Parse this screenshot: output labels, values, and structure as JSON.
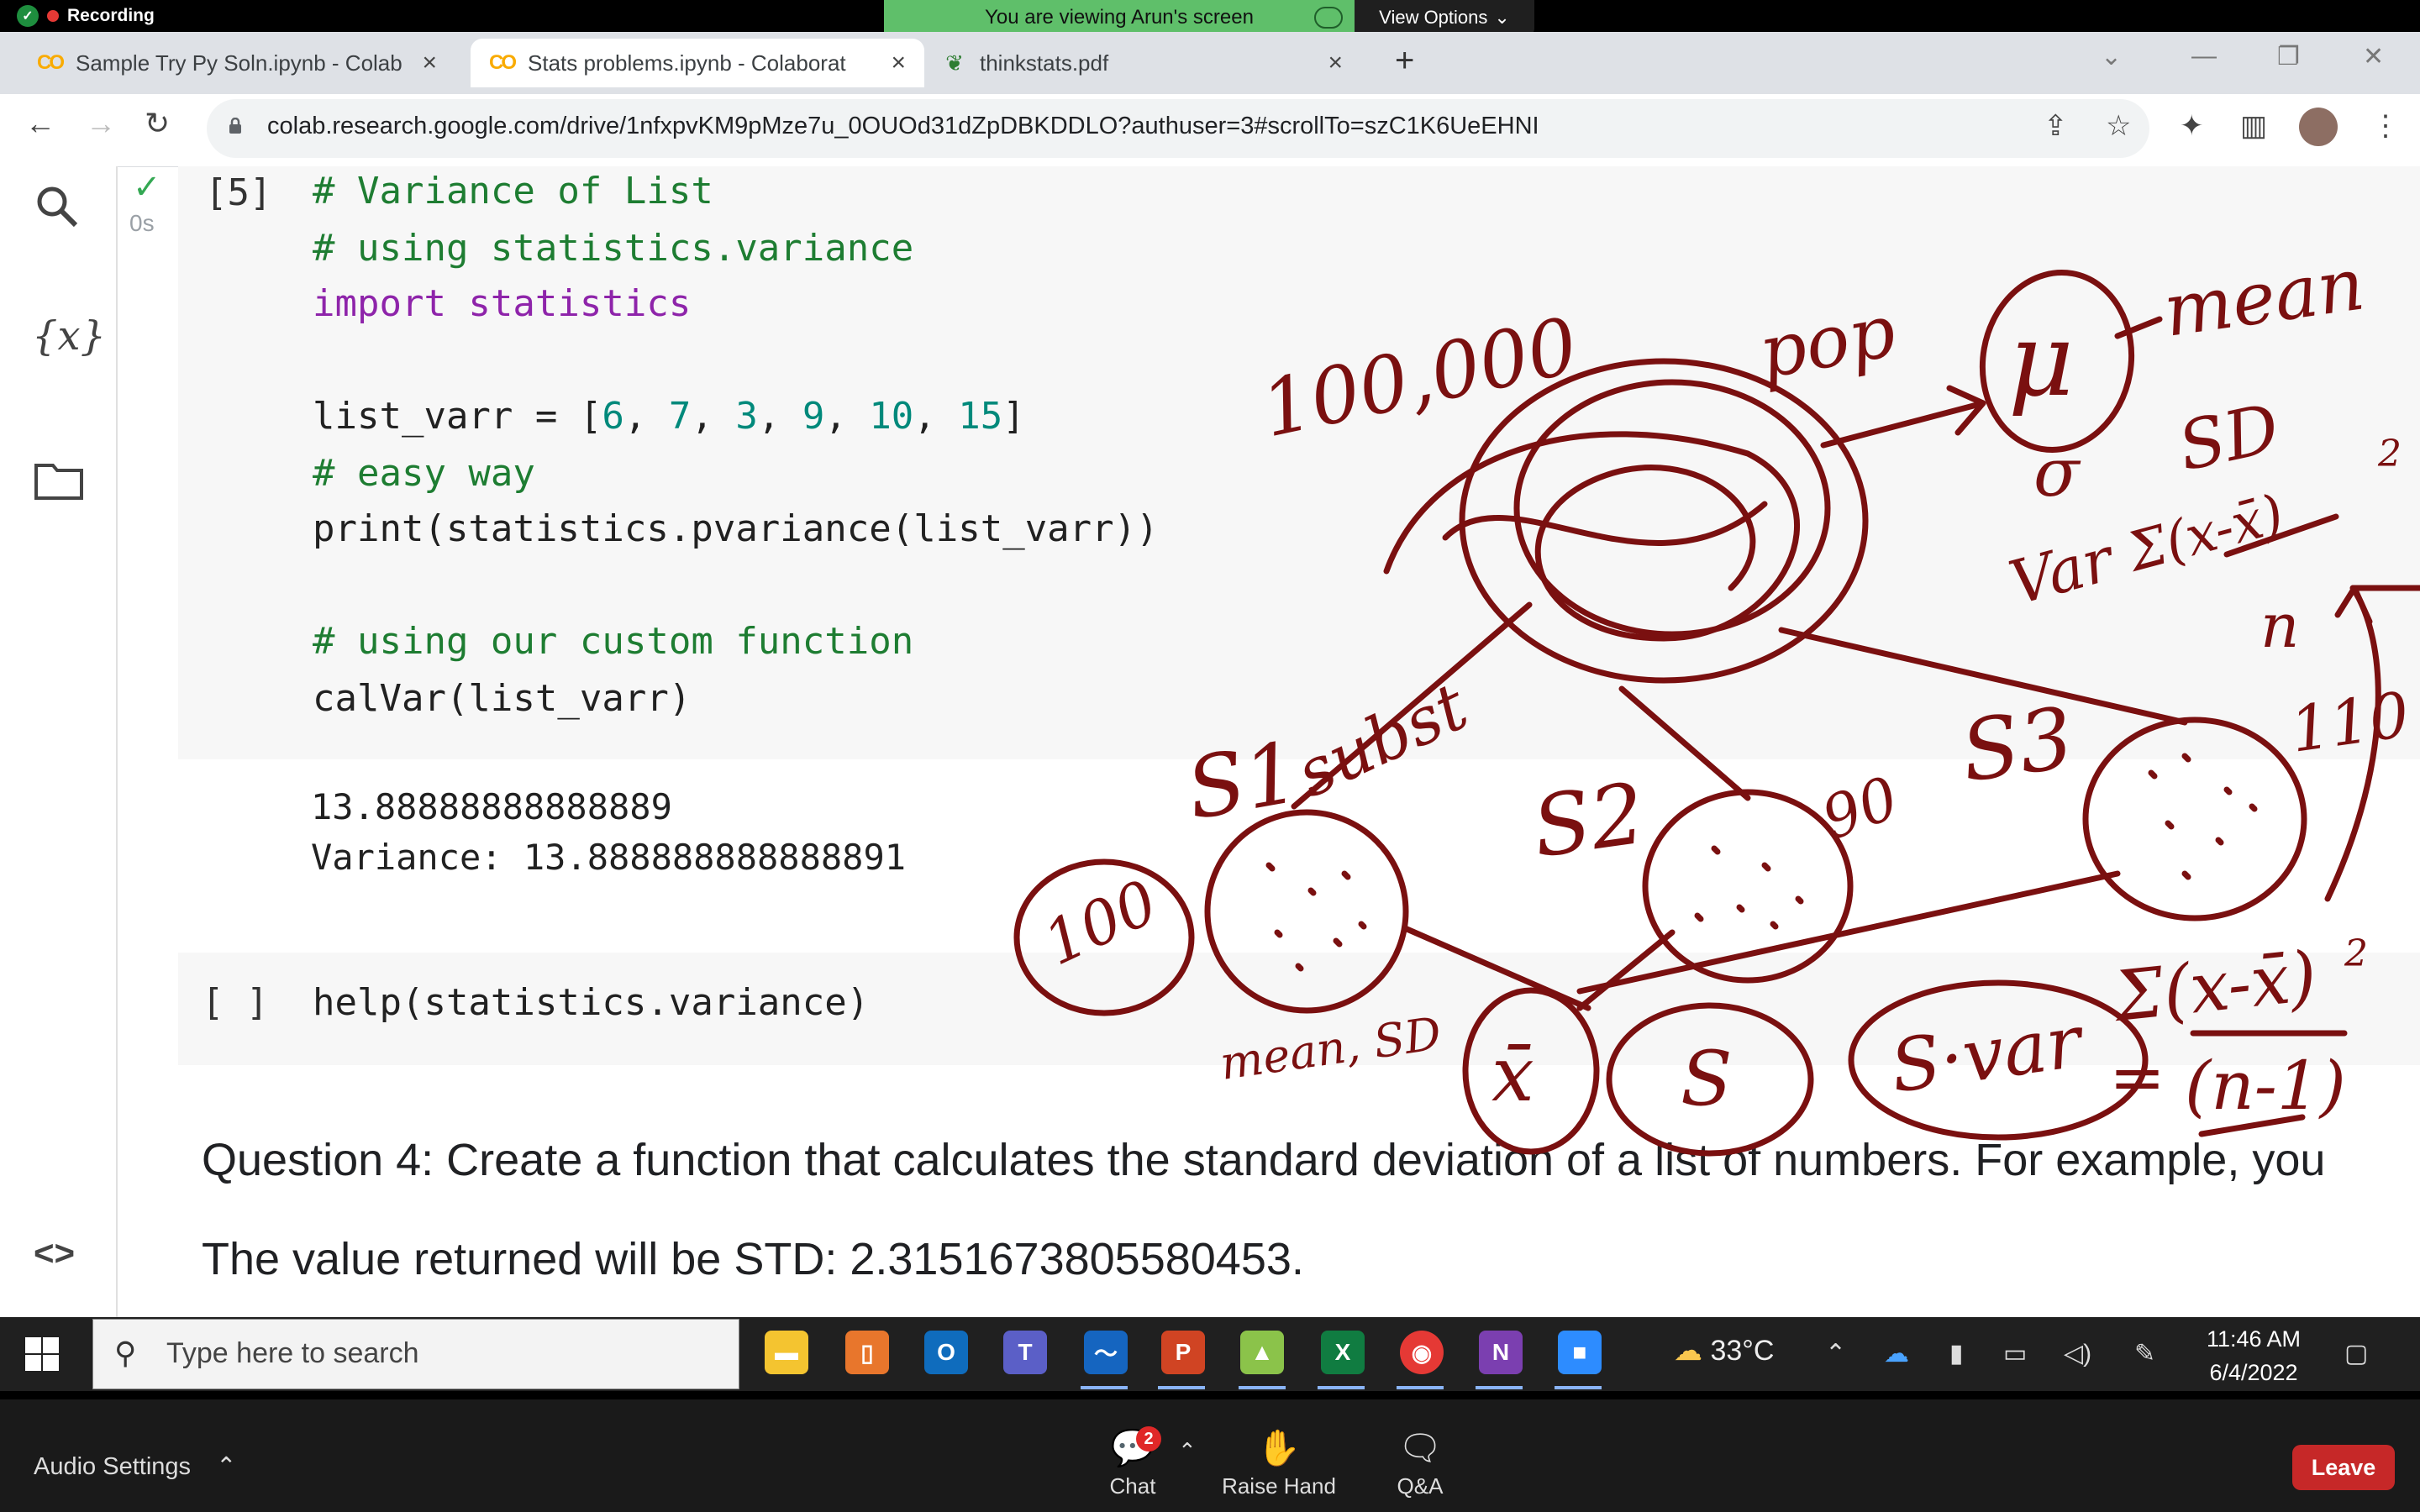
{
  "screen_share": {
    "recording_label": "Recording",
    "viewing_text": "You are viewing Arun's screen",
    "view_options_label": "View Options"
  },
  "browser": {
    "tabs": [
      {
        "label": "Sample Try Py Soln.ipynb - Colab",
        "icon": "colab-icon",
        "active": false
      },
      {
        "label": "Stats problems.ipynb - Colaborat",
        "icon": "colab-icon",
        "active": true
      },
      {
        "label": "thinkstats.pdf",
        "icon": "leaf-icon",
        "active": false
      }
    ],
    "url": "colab.research.google.com/drive/1nfxpvKM9pMze7u_0OUOd31dZpDBKDDLO?authuser=3#scrollTo=szC1K6UeEHNI"
  },
  "notebook": {
    "cell1": {
      "exec_count": "[5]",
      "runtime": "0s",
      "code_lines": [
        "# Variance of List",
        "# using statistics.variance",
        "import statistics",
        "",
        "list_varr = [6, 7, 3, 9, 10, 15]",
        "# easy way",
        "print(statistics.pvariance(list_varr))",
        "",
        "# using our custom function",
        "calVar(list_varr)"
      ],
      "output_lines": [
        "13.88888888888889",
        "Variance: 13.888888888888891"
      ]
    },
    "cell2": {
      "exec_count": "[ ]",
      "code": "help(statistics.variance)"
    },
    "markdown": {
      "q4": "Question 4: Create a function that calculates the standard deviation of a list of numbers. For example, you",
      "std": "The value returned will be STD: 2.3151673805580453."
    }
  },
  "annotations": {
    "labels": [
      "100,000",
      "pop",
      "μ",
      "mean",
      "σ",
      "SD",
      "Var",
      "Σ(x-x̄)",
      "2",
      "n",
      "S1",
      "subst",
      "S2",
      "S3",
      "100",
      "90",
      "110",
      "mean, SD",
      "x̄",
      "S",
      "S·var",
      "Σ(x-x̄)",
      "2",
      "=",
      "(n-1)"
    ]
  },
  "taskbar": {
    "search_placeholder": "Type here to search",
    "temperature": "33°C",
    "time": "11:46 AM",
    "date": "6/4/2022"
  },
  "zoom": {
    "audio_label": "Audio Settings",
    "chat_label": "Chat",
    "chat_badge": "2",
    "raise_hand_label": "Raise Hand",
    "qa_label": "Q&A",
    "leave_label": "Leave"
  },
  "colors": {
    "ink": "#7a1010",
    "share_green": "#5fbf6a",
    "leave_red": "#c62828"
  }
}
